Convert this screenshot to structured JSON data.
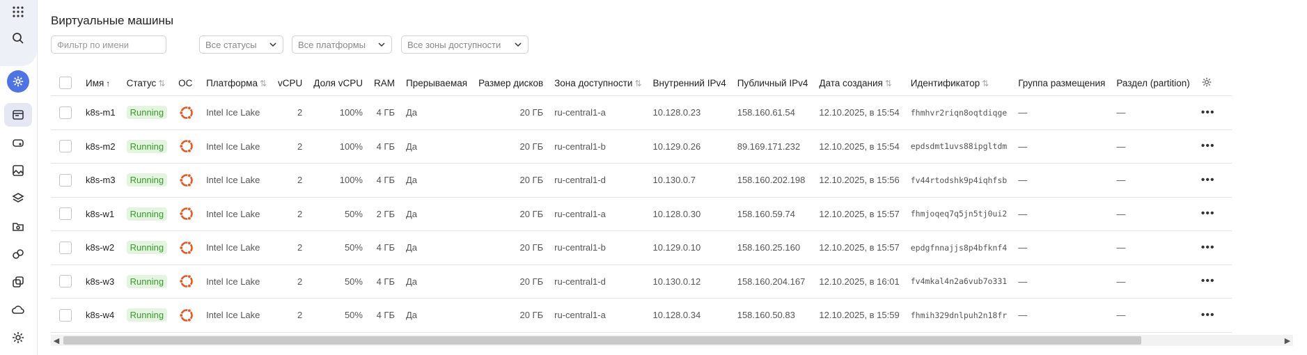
{
  "page_title": "Виртуальные машины",
  "filters": {
    "name_placeholder": "Фильтр по имени",
    "status": "Все статусы",
    "platform": "Все платформы",
    "zone": "Все зоны доступности"
  },
  "columns": {
    "name": "Имя",
    "status": "Статус",
    "os": "ОС",
    "platform": "Платформа",
    "vcpu": "vCPU",
    "vcpu_share": "Доля vCPU",
    "ram": "RAM",
    "preemptible": "Прерываемая",
    "disk_size": "Размер дисков",
    "zone": "Зона доступности",
    "internal_ip": "Внутренний IPv4",
    "public_ip": "Публичный IPv4",
    "created": "Дата создания",
    "id": "Идентификатор",
    "placement_group": "Группа размещения",
    "partition": "Раздел (partition)"
  },
  "rows": [
    {
      "name": "k8s-m1",
      "status": "Running",
      "platform": "Intel Ice Lake",
      "vcpu": "2",
      "vcpu_share": "100%",
      "ram": "4 ГБ",
      "preemptible": "Да",
      "disk": "20 ГБ",
      "zone": "ru-central1-a",
      "internal_ip": "10.128.0.23",
      "public_ip": "158.160.61.54",
      "created": "12.10.2025, в 15:54",
      "id": "fhmhvr2riqn8oqtdiqge",
      "placement_group": "—",
      "partition": "—"
    },
    {
      "name": "k8s-m2",
      "status": "Running",
      "platform": "Intel Ice Lake",
      "vcpu": "2",
      "vcpu_share": "100%",
      "ram": "4 ГБ",
      "preemptible": "Да",
      "disk": "20 ГБ",
      "zone": "ru-central1-b",
      "internal_ip": "10.129.0.26",
      "public_ip": "89.169.171.232",
      "created": "12.10.2025, в 15:54",
      "id": "epdsdmt1uvs88ipgltdm",
      "placement_group": "—",
      "partition": "—"
    },
    {
      "name": "k8s-m3",
      "status": "Running",
      "platform": "Intel Ice Lake",
      "vcpu": "2",
      "vcpu_share": "100%",
      "ram": "4 ГБ",
      "preemptible": "Да",
      "disk": "20 ГБ",
      "zone": "ru-central1-d",
      "internal_ip": "10.130.0.7",
      "public_ip": "158.160.202.198",
      "created": "12.10.2025, в 15:56",
      "id": "fv44rtodshk9p4iqhfsb",
      "placement_group": "—",
      "partition": "—"
    },
    {
      "name": "k8s-w1",
      "status": "Running",
      "platform": "Intel Ice Lake",
      "vcpu": "2",
      "vcpu_share": "50%",
      "ram": "2 ГБ",
      "preemptible": "Да",
      "disk": "20 ГБ",
      "zone": "ru-central1-a",
      "internal_ip": "10.128.0.30",
      "public_ip": "158.160.59.74",
      "created": "12.10.2025, в 15:57",
      "id": "fhmjoqeq7q5jn5tj0ui2",
      "placement_group": "—",
      "partition": "—"
    },
    {
      "name": "k8s-w2",
      "status": "Running",
      "platform": "Intel Ice Lake",
      "vcpu": "2",
      "vcpu_share": "50%",
      "ram": "4 ГБ",
      "preemptible": "Да",
      "disk": "20 ГБ",
      "zone": "ru-central1-b",
      "internal_ip": "10.129.0.10",
      "public_ip": "158.160.25.160",
      "created": "12.10.2025, в 15:57",
      "id": "epdgfnnajjs8p4bfknf4",
      "placement_group": "—",
      "partition": "—"
    },
    {
      "name": "k8s-w3",
      "status": "Running",
      "platform": "Intel Ice Lake",
      "vcpu": "2",
      "vcpu_share": "50%",
      "ram": "4 ГБ",
      "preemptible": "Да",
      "disk": "20 ГБ",
      "zone": "ru-central1-d",
      "internal_ip": "10.130.0.12",
      "public_ip": "158.160.204.167",
      "created": "12.10.2025, в 16:01",
      "id": "fv4mkal4n2a6vub7o331",
      "placement_group": "—",
      "partition": "—"
    },
    {
      "name": "k8s-w4",
      "status": "Running",
      "platform": "Intel Ice Lake",
      "vcpu": "2",
      "vcpu_share": "50%",
      "ram": "4 ГБ",
      "preemptible": "Да",
      "disk": "20 ГБ",
      "zone": "ru-central1-a",
      "internal_ip": "10.128.0.34",
      "public_ip": "158.160.50.83",
      "created": "12.10.2025, в 15:59",
      "id": "fhmih329dnlpuh2n18fr",
      "placement_group": "—",
      "partition": "—"
    }
  ],
  "colors": {
    "accent": "#4d73e6",
    "status_bg": "#e3f4df",
    "status_text": "#3a9a2e",
    "ubuntu": "#e95420"
  },
  "sidebar_icons": [
    "grid-icon",
    "search-icon",
    "settings-icon",
    "vm-icon",
    "disk-icon",
    "image-icon",
    "layers-icon",
    "snapshot-icon",
    "group-icon",
    "copy-icon",
    "cloud-icon",
    "gear-icon"
  ]
}
